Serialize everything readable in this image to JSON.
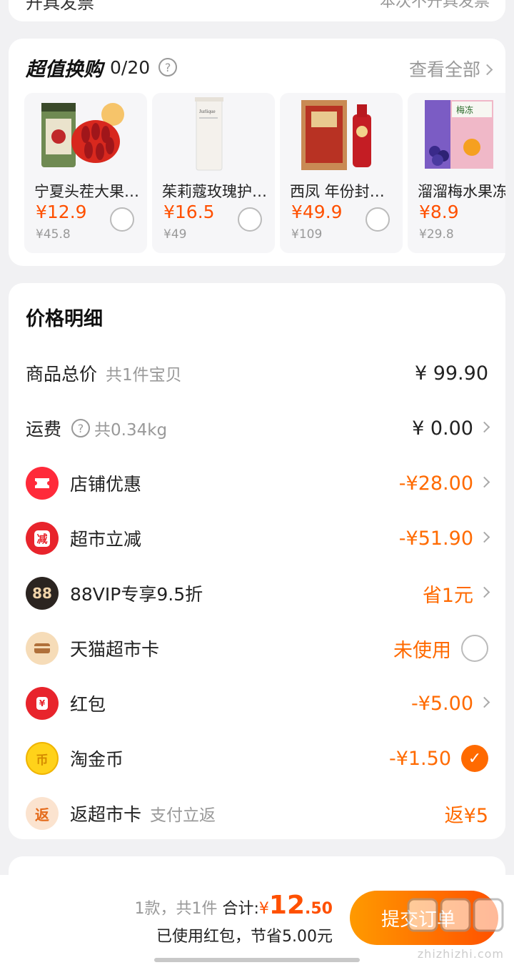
{
  "top_card": {
    "left_text": "开具发票",
    "right_text": "本次不开具发票"
  },
  "swap": {
    "title": "超值换购",
    "count": "0/20",
    "view_all": "查看全部",
    "products": [
      {
        "name": "宁夏头茬大果枸杞",
        "price": "¥12.9",
        "original": "¥45.8",
        "icon": "goji-jar-image"
      },
      {
        "name": "茱莉蔻玫瑰护手霜",
        "price": "¥16.5",
        "original": "¥49",
        "icon": "hand-cream-tube-image"
      },
      {
        "name": "西凤 年份封藏酒",
        "price": "¥49.9",
        "original": "¥109",
        "icon": "liquor-box-image"
      },
      {
        "name": "溜溜梅水果冻",
        "price": "¥8.9",
        "original": "¥29.8",
        "icon": "jelly-pack-image"
      }
    ]
  },
  "price_detail": {
    "title": "价格明细",
    "rows": [
      {
        "label": "商品总价",
        "sub": "共1件宝贝",
        "value": "¥ 99.90"
      },
      {
        "label": "运费",
        "sub": "共0.34kg",
        "value": "¥ 0.00"
      },
      {
        "label": "店铺优惠",
        "value": "-¥28.00",
        "icon": "ticket-icon",
        "icon_text": ""
      },
      {
        "label": "超市立减",
        "value": "-¥51.90",
        "icon": "discount-icon",
        "icon_text": "减"
      },
      {
        "label": "88VIP专享9.5折",
        "value": "省1元",
        "icon": "vip88-icon",
        "icon_text": "88"
      },
      {
        "label": "天猫超市卡",
        "value": "未使用",
        "icon": "card-icon",
        "icon_text": ""
      },
      {
        "label": "红包",
        "value": "-¥5.00",
        "icon": "red-packet-icon",
        "icon_text": "¥"
      },
      {
        "label": "淘金币",
        "value": "-¥1.50",
        "icon": "gold-coin-icon",
        "icon_text": "币"
      },
      {
        "label": "返超市卡",
        "sub": "支付立返",
        "value": "返¥5",
        "icon": "rebate-icon",
        "icon_text": "返"
      }
    ]
  },
  "bottom": {
    "count_text": "1款，共1件",
    "total_label": "合计:",
    "currency": "¥",
    "total_int": "12",
    "total_dec": ".50",
    "saving_text": "已使用红包，节省5.00元",
    "submit_label": "提交订单",
    "watermark": "zhizhizhi.com"
  },
  "colors": {
    "accent": "#ff6a00",
    "price": "#ff5000",
    "background": "#f1f1f3"
  }
}
